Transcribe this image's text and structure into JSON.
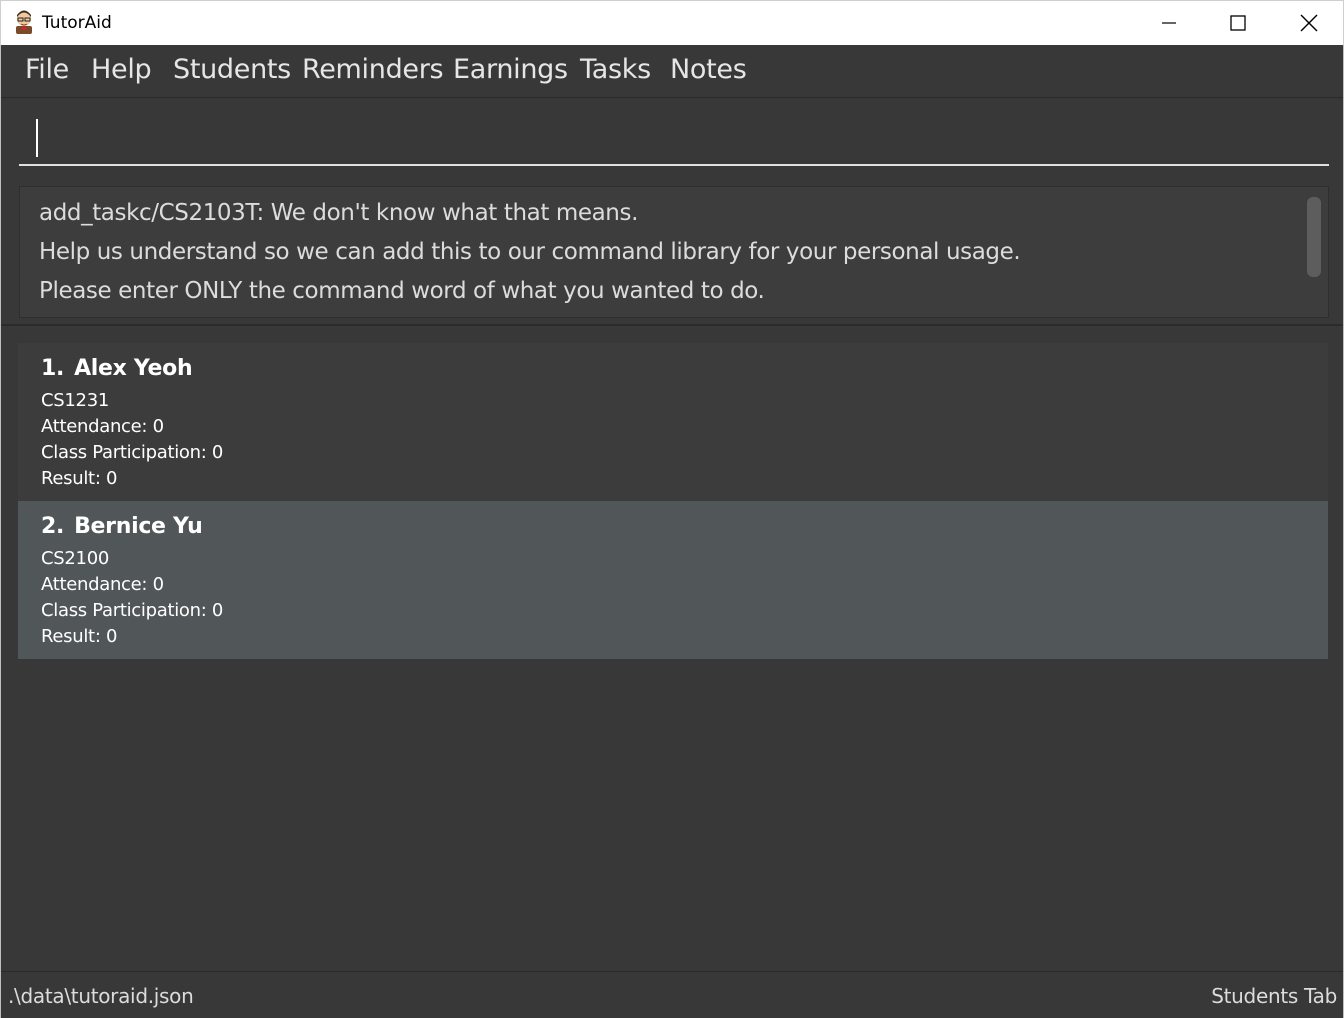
{
  "window": {
    "title": "TutorAid",
    "icon": "tutor-avatar-icon",
    "controls": [
      "minimize-icon",
      "maximize-icon",
      "close-icon"
    ]
  },
  "menu": {
    "items": [
      "File",
      "Help",
      "Students",
      "Reminders",
      "Earnings",
      "Tasks",
      "Notes"
    ]
  },
  "command": {
    "value": ""
  },
  "result": {
    "lines": [
      "add_taskc/CS2103T: We don't know what that means.",
      "Help us understand so we can add this to our command library for your personal usage.",
      "Please enter ONLY the command word of what you wanted to do."
    ]
  },
  "students": [
    {
      "index": "1.",
      "name": "Alex Yeoh",
      "module": "CS1231",
      "attendance": "Attendance: 0",
      "participation": "Class Participation: 0",
      "result": "Result: 0"
    },
    {
      "index": "2.",
      "name": "Bernice Yu",
      "module": "CS2100",
      "attendance": "Attendance: 0",
      "participation": "Class Participation: 0",
      "result": "Result: 0"
    }
  ],
  "status": {
    "file_path": ".\\data\\tutoraid.json",
    "current_tab": "Students Tab"
  },
  "colors": {
    "background": "#383838",
    "selected_card": "#515658",
    "text": "#ffffff"
  }
}
